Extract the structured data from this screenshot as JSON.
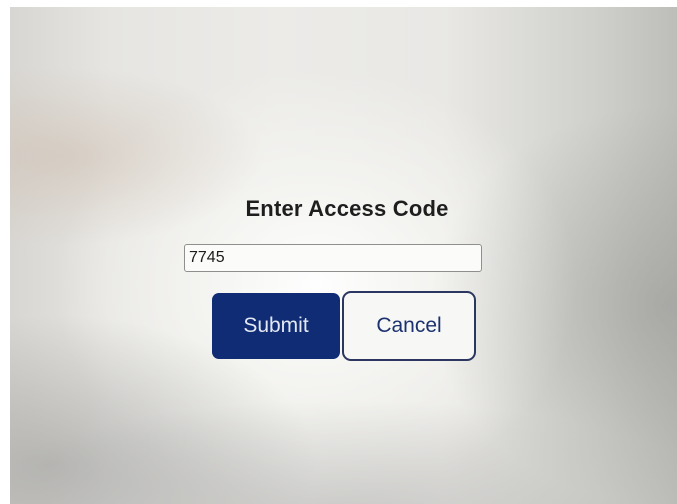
{
  "dialog": {
    "title": "Enter Access Code",
    "code_value": "7745",
    "submit_label": "Submit",
    "cancel_label": "Cancel"
  },
  "colors": {
    "submit_bg": "#0f2c74",
    "cancel_border": "#2b3760"
  }
}
